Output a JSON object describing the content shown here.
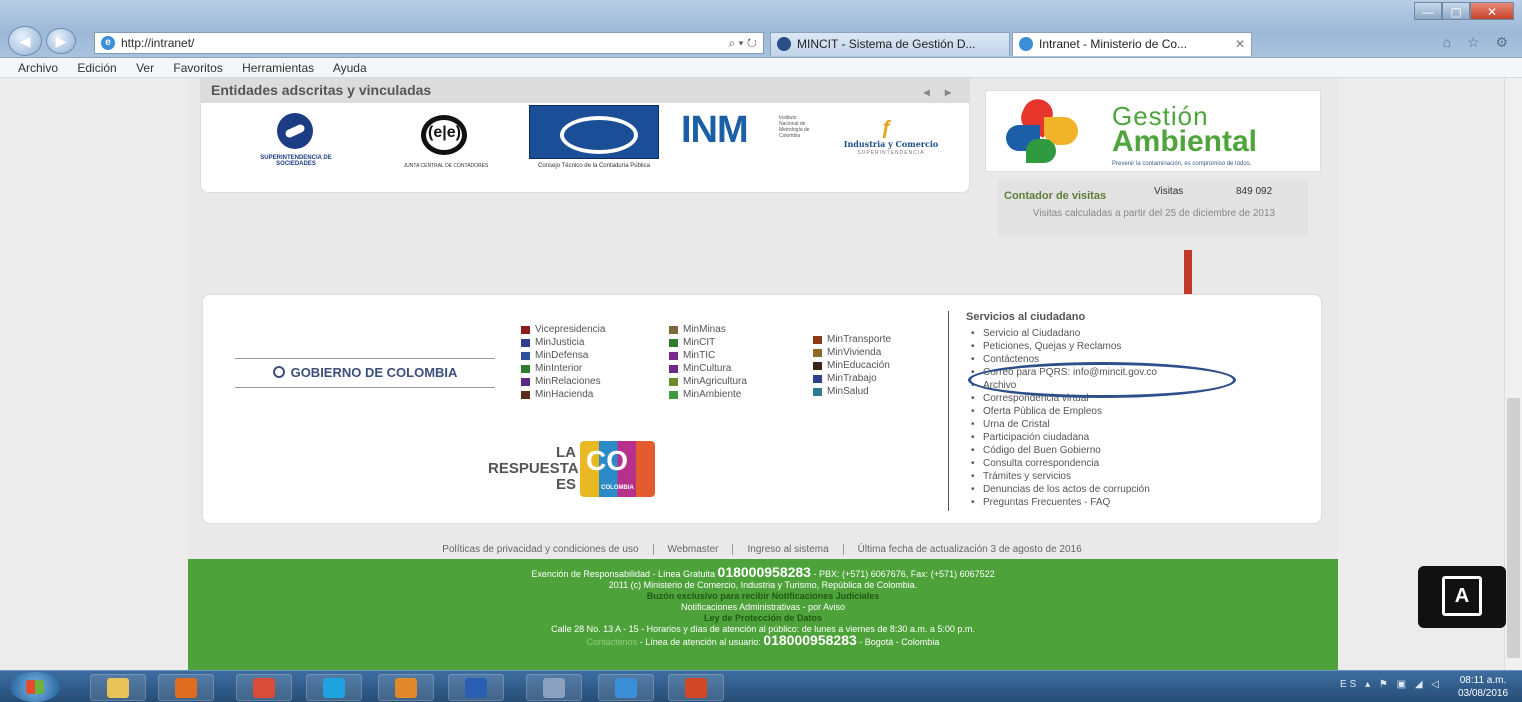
{
  "browser": {
    "address": "http://intranet/",
    "address_tools": "⌕ ▾ ↻",
    "tabs": [
      {
        "label": "MINCIT - Sistema de Gestión D..."
      },
      {
        "label": "Intranet - Ministerio de Co...",
        "close": "✕"
      }
    ],
    "window_controls": {
      "minimize": "—",
      "maximize": "▢",
      "close": "✕"
    },
    "toolbar_icons": "⌂ ☆ ⚙",
    "menu": [
      "Archivo",
      "Edición",
      "Ver",
      "Favoritos",
      "Herramientas",
      "Ayuda"
    ]
  },
  "entidades": {
    "title": "Entidades adscritas y vinculadas",
    "arrows": "◂ ▸",
    "logos": {
      "super": "SUPERINTENDENCIA DE SOCIEDADES",
      "jcc": "JUNTA CENTRAL DE CONTADORES",
      "ctcp": "Consejo Técnico de la Contaduría Pública",
      "inm": "INM",
      "inm_small": "Instituto Nacional de Metrología de Colombia",
      "ic_title": "Industria y Comercio",
      "ic_sub": "SUPERINTENDENCIA"
    }
  },
  "ambiental": {
    "title1": "Gestión",
    "title2": "Ambiental",
    "subtitle": "Prevenir la contaminación, es compromiso de todos."
  },
  "contador": {
    "title": "Contador de visitas",
    "visits_label": "Visitas",
    "visits_value": "849 092",
    "note": "Visitas calculadas a partir del 25 de diciembre de 2013"
  },
  "gobierno": {
    "label": "GOBIERNO DE COLOMBIA"
  },
  "ministerios": {
    "col1": [
      {
        "label": "Vicepresidencia",
        "color": "#8b1a1a"
      },
      {
        "label": "MinJusticia",
        "color": "#2f3f8f"
      },
      {
        "label": "MinDefensa",
        "color": "#2f4f9f"
      },
      {
        "label": "MinInterior",
        "color": "#2e7d2e"
      },
      {
        "label": "MinRelaciones",
        "color": "#5b2a86"
      },
      {
        "label": "MinHacienda",
        "color": "#5a2d1c"
      }
    ],
    "col2": [
      {
        "label": "MinMinas",
        "color": "#7a6a3a"
      },
      {
        "label": "MinCIT",
        "color": "#2e7d2e"
      },
      {
        "label": "MinTIC",
        "color": "#7a2c8c"
      },
      {
        "label": "MinCultura",
        "color": "#6a2a86"
      },
      {
        "label": "MinAgricultura",
        "color": "#6c8c2a"
      },
      {
        "label": "MinAmbiente",
        "color": "#3e9a3e"
      }
    ],
    "col3": [
      {
        "label": "MinTransporte",
        "color": "#8b3a1a"
      },
      {
        "label": "MinVivienda",
        "color": "#8a6a2a"
      },
      {
        "label": "MinEducación",
        "color": "#3a2418"
      },
      {
        "label": "MinTrabajo",
        "color": "#2f3f8f"
      },
      {
        "label": "MinSalud",
        "color": "#2a7d8c"
      }
    ]
  },
  "la_respuesta": {
    "text": "LA RESPUESTA ES",
    "co": "CO",
    "colombia": "COLOMBIA"
  },
  "servicios": {
    "title": "Servicios al ciudadano",
    "items": [
      "Servicio al Ciudadano",
      "Peticiones, Quejas y Reclamos",
      "Contáctenos",
      "Correo para PQRS: info@mincit.gov.co",
      "Archivo",
      "Correspondencia virtual",
      "Oferta Pública de Empleos",
      "Urna de Cristal",
      "Participación ciudadana",
      "Código del Buen Gobierno",
      "Consulta correspondencia",
      "Trámites y servicios",
      "Denuncias de los actos de corrupción",
      "Preguntas Frecuentes - FAQ"
    ]
  },
  "footer_links": [
    "Políticas de privacidad y condiciones de uso",
    "Webmaster",
    "Ingreso al sistema",
    "Última fecha de actualización 3 de agosto de 2016"
  ],
  "green_footer": {
    "l1a": "Exención de Responsabilidad - Línea Gratuita",
    "l1b": "018000958283",
    "l1c": "- PBX: (+571) 6067676, Fax: (+571) 6067522",
    "l2": "2011 (c) Ministerio de Comercio, Industria y Turismo, República de Colombia.",
    "l3": "Buzón exclusivo para recibir Notificaciones Judiciales",
    "l4": "Notificaciones Administrativas - por Aviso",
    "l5": "Ley de Protección de Datos",
    "l6": "Calle 28 No. 13 A - 15 - Horarios y días de atención al público: de lunes a viernes de 8:30 a.m. a 5:00 p.m.",
    "l7a": "Contáctenos",
    "l7b": "- Línea de atención al usuario:",
    "l7c": "018000958283",
    "l7d": "- Bogotá - Colombia"
  },
  "accessibility": {
    "label": "A"
  },
  "taskbar": {
    "apps": [
      {
        "name": "explorer",
        "color": "#e8c35a"
      },
      {
        "name": "media-player",
        "color": "#e06d1f"
      },
      {
        "name": "chrome",
        "color": "#d94c3a"
      },
      {
        "name": "skype",
        "color": "#1fa3e0"
      },
      {
        "name": "outlook",
        "color": "#e0892a"
      },
      {
        "name": "word",
        "color": "#2b5fb4"
      },
      {
        "name": "paint",
        "color": "#8aa1c0"
      },
      {
        "name": "internet-explorer",
        "color": "#3a8fd8"
      },
      {
        "name": "powerpoint",
        "color": "#d24726"
      }
    ],
    "tray": "ES ▴ ⚑ ▣ ◢ ◁",
    "time": "08:11 a.m.",
    "date": "03/08/2016"
  }
}
